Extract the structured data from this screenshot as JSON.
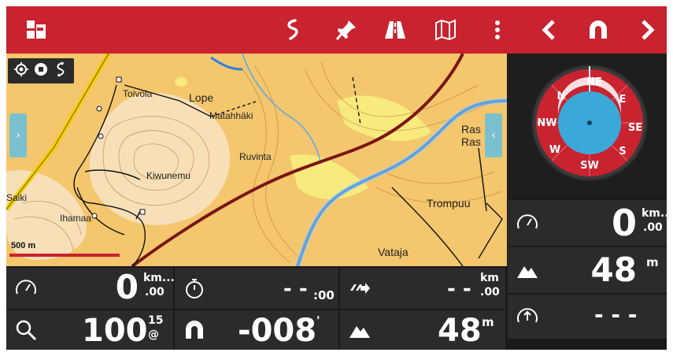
{
  "toolbar": {
    "buttons": [
      {
        "name": "logo",
        "icon": "app-logo-icon"
      },
      {
        "name": "track",
        "icon": "track-route-icon"
      },
      {
        "name": "pin",
        "icon": "pushpin-icon"
      },
      {
        "name": "road",
        "icon": "road-icon"
      },
      {
        "name": "map",
        "icon": "map-icon"
      },
      {
        "name": "more",
        "icon": "more-vertical-icon"
      },
      {
        "name": "prev",
        "icon": "chevron-left-icon"
      },
      {
        "name": "magnet",
        "icon": "magnet-icon"
      },
      {
        "name": "next",
        "icon": "chevron-right-icon"
      }
    ],
    "color": "#c8232f"
  },
  "map": {
    "places": [
      "Toivola",
      "Lope",
      "Matahhäki",
      "Ruvinta",
      "Kiwunemu",
      "Ihamaa",
      "Saiki",
      "Trompuu",
      "Vataja",
      "Ras",
      "Ras"
    ],
    "scale_label": "500 m",
    "tool_icons": [
      "locate-icon",
      "stop-record-icon",
      "track-icon"
    ]
  },
  "compass": {
    "labels": [
      "NE",
      "E",
      "SE",
      "S",
      "SW",
      "W",
      "NW",
      "N"
    ],
    "ring_color": "#c8232f",
    "face_color": "#3aa9d9"
  },
  "dash": {
    "speed": {
      "value": "0",
      "unit_top": "km...",
      "unit_bottom": ".00"
    },
    "timer": {
      "value": "- -",
      "unit": ":00"
    },
    "distance": {
      "value": "- -",
      "unit_top": "km",
      "unit_bottom": ".00"
    },
    "zoom": {
      "value": "100",
      "unit_top": "15",
      "unit_bottom": "@"
    },
    "heading": {
      "value": "-008",
      "unit": "'"
    },
    "altitude": {
      "value": "48",
      "unit": "m"
    }
  },
  "side": {
    "speed": {
      "value": "0",
      "unit_top": "km...",
      "unit_bottom": ".00"
    },
    "altitude": {
      "value": "48",
      "unit": "m"
    },
    "vario": {
      "value": "- - -"
    }
  }
}
